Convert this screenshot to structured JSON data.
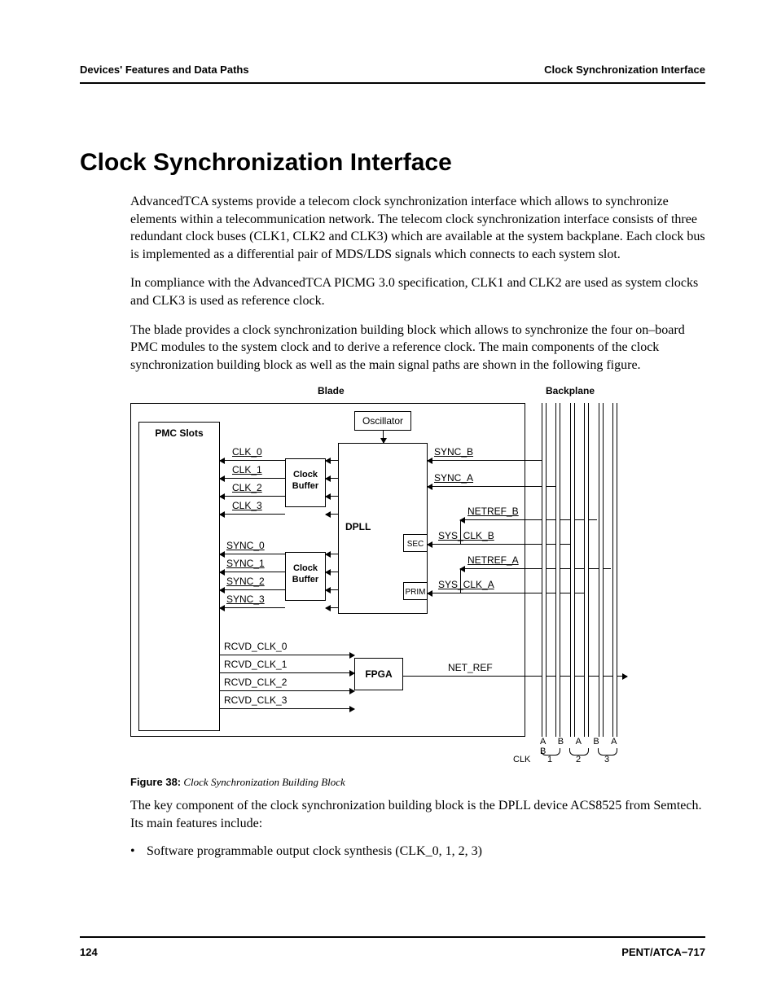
{
  "header": {
    "left": "Devices' Features and Data Paths",
    "right": "Clock Synchronization Interface"
  },
  "title": "Clock Synchronization Interface",
  "paragraphs": {
    "p1": "AdvancedTCA systems provide a telecom clock synchronization interface which allows to synchronize elements within a telecommunication network. The telecom clock synchronization interface consists of three redundant clock buses (CLK1, CLK2 and CLK3) which are available at the system backplane. Each clock bus is implemented as a differential pair of MDS/LDS signals which connects to each system slot.",
    "p2": "In compliance with the AdvancedTCA PICMG 3.0 specification, CLK1 and CLK2 are used as system clocks and CLK3 is used as reference clock.",
    "p3": "The blade provides a clock synchronization building block which allows to synchronize the four on–board PMC modules to the system clock and to derive a reference clock. The main components of the clock synchronization building block as well as the main signal paths are shown in the following figure.",
    "p4": "The key component of the clock synchronization building block is the DPLL device ACS8525 from Semtech. Its main features include:"
  },
  "diagram": {
    "blade_label": "Blade",
    "backplane_label": "Backplane",
    "pmc_slots": "PMC Slots",
    "oscillator": "Oscillator",
    "clock_buffer": "Clock Buffer",
    "dpll": "DPLL",
    "sec": "SEC",
    "prim": "PRIM",
    "fpga": "FPGA",
    "clk": [
      "CLK_0",
      "CLK_1",
      "CLK_2",
      "CLK_3"
    ],
    "sync": [
      "SYNC_0",
      "SYNC_1",
      "SYNC_2",
      "SYNC_3"
    ],
    "rcvd": [
      "RCVD_CLK_0",
      "RCVD_CLK_1",
      "RCVD_CLK_2",
      "RCVD_CLK_3"
    ],
    "sync_b": "SYNC_B",
    "sync_a": "SYNC_A",
    "netref_b": "NETREF_B",
    "sys_clk_b": "SYS_CLK_B",
    "netref_a": "NETREF_A",
    "sys_clk_a": "SYS_CLK_A",
    "net_ref": "NET_REF",
    "ab_label": "A B A B A B",
    "clk_row_label": "CLK",
    "clk_nums": [
      "1",
      "2",
      "3"
    ]
  },
  "figure": {
    "label": "Figure 38:",
    "title": "Clock Synchronization Building Block"
  },
  "features": {
    "f1": "Software programmable output clock synthesis (CLK_0, 1, 2, 3)"
  },
  "footer": {
    "page": "124",
    "doc": "PENT/ATCA−717"
  }
}
